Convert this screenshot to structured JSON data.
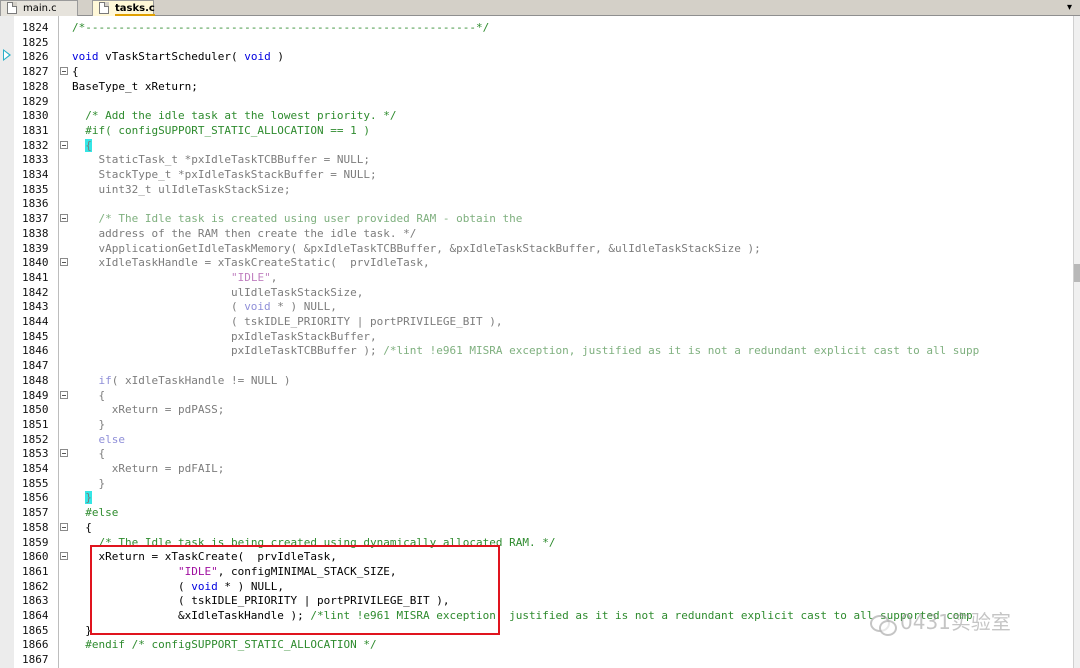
{
  "tabs": [
    {
      "label": "main.c",
      "active": false
    },
    {
      "label": "tasks.c",
      "active": true
    }
  ],
  "dropdown_glyph": "▾",
  "watermark": {
    "text": "0431实验室"
  },
  "lines": [
    {
      "n": "1824",
      "t": "/*-----------------------------------------------------------*/"
    },
    {
      "n": "1825",
      "t": ""
    },
    {
      "n": "1826",
      "t": "void vTaskStartScheduler( void )"
    },
    {
      "n": "1827",
      "t": "{"
    },
    {
      "n": "1828",
      "t": "BaseType_t xReturn;"
    },
    {
      "n": "1829",
      "t": ""
    },
    {
      "n": "1830",
      "t": "  /* Add the idle task at the lowest priority. */"
    },
    {
      "n": "1831",
      "t": "  #if( configSUPPORT_STATIC_ALLOCATION == 1 )"
    },
    {
      "n": "1832",
      "t": "  {"
    },
    {
      "n": "1833",
      "t": "    StaticTask_t *pxIdleTaskTCBBuffer = NULL;"
    },
    {
      "n": "1834",
      "t": "    StackType_t *pxIdleTaskStackBuffer = NULL;"
    },
    {
      "n": "1835",
      "t": "    uint32_t ulIdleTaskStackSize;"
    },
    {
      "n": "1836",
      "t": ""
    },
    {
      "n": "1837",
      "t": "    /* The Idle task is created using user provided RAM - obtain the"
    },
    {
      "n": "1838",
      "t": "    address of the RAM then create the idle task. */"
    },
    {
      "n": "1839",
      "t": "    vApplicationGetIdleTaskMemory( &pxIdleTaskTCBBuffer, &pxIdleTaskStackBuffer, &ulIdleTaskStackSize );"
    },
    {
      "n": "1840",
      "t": "    xIdleTaskHandle = xTaskCreateStatic(  prvIdleTask,"
    },
    {
      "n": "1841",
      "t": "                        \"IDLE\","
    },
    {
      "n": "1842",
      "t": "                        ulIdleTaskStackSize,"
    },
    {
      "n": "1843",
      "t": "                        ( void * ) NULL,"
    },
    {
      "n": "1844",
      "t": "                        ( tskIDLE_PRIORITY | portPRIVILEGE_BIT ),"
    },
    {
      "n": "1845",
      "t": "                        pxIdleTaskStackBuffer,"
    },
    {
      "n": "1846",
      "t": "                        pxIdleTaskTCBBuffer ); /*lint !e961 MISRA exception, justified as it is not a redundant explicit cast to all supp"
    },
    {
      "n": "1847",
      "t": ""
    },
    {
      "n": "1848",
      "t": "    if( xIdleTaskHandle != NULL )"
    },
    {
      "n": "1849",
      "t": "    {"
    },
    {
      "n": "1850",
      "t": "      xReturn = pdPASS;"
    },
    {
      "n": "1851",
      "t": "    }"
    },
    {
      "n": "1852",
      "t": "    else"
    },
    {
      "n": "1853",
      "t": "    {"
    },
    {
      "n": "1854",
      "t": "      xReturn = pdFAIL;"
    },
    {
      "n": "1855",
      "t": "    }"
    },
    {
      "n": "1856",
      "t": "  }"
    },
    {
      "n": "1857",
      "t": "  #else"
    },
    {
      "n": "1858",
      "t": "  {"
    },
    {
      "n": "1859",
      "t": "    /* The Idle task is being created using dynamically allocated RAM. */"
    },
    {
      "n": "1860",
      "t": "    xReturn = xTaskCreate(  prvIdleTask,"
    },
    {
      "n": "1861",
      "t": "                \"IDLE\", configMINIMAL_STACK_SIZE,"
    },
    {
      "n": "1862",
      "t": "                ( void * ) NULL,"
    },
    {
      "n": "1863",
      "t": "                ( tskIDLE_PRIORITY | portPRIVILEGE_BIT ),"
    },
    {
      "n": "1864",
      "t": "                &xIdleTaskHandle ); /*lint !e961 MISRA exception, justified as it is not a redundant explicit cast to all supported comp"
    },
    {
      "n": "1865",
      "t": "  }"
    },
    {
      "n": "1866",
      "t": "  #endif /* configSUPPORT_STATIC_ALLOCATION */"
    },
    {
      "n": "1867",
      "t": ""
    }
  ]
}
